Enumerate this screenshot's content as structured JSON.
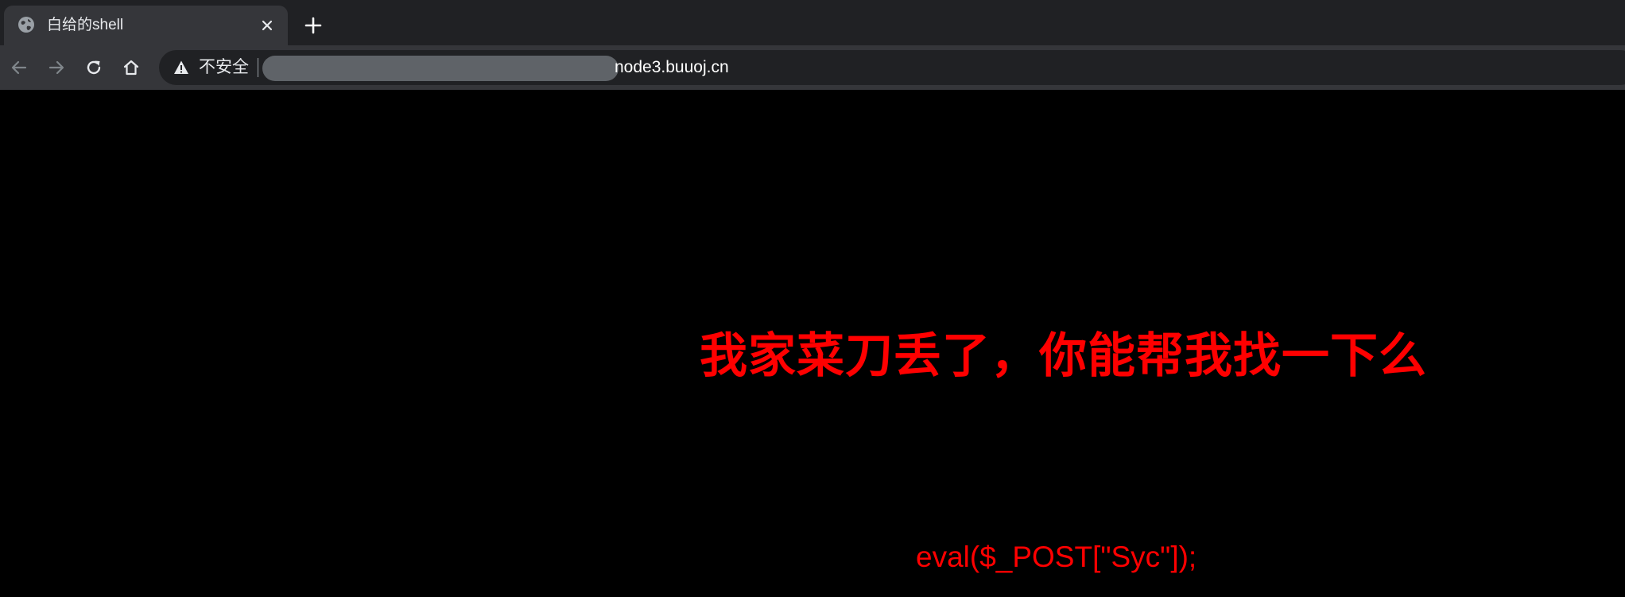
{
  "tab": {
    "title": "白给的shell",
    "favicon": "globe-icon",
    "close_icon": "close-icon"
  },
  "new_tab_icon": "plus-icon",
  "toolbar": {
    "back_icon": "back-arrow-icon",
    "forward_icon": "forward-arrow-icon",
    "reload_icon": "reload-icon",
    "home_icon": "home-icon"
  },
  "omnibox": {
    "security_icon": "warning-icon",
    "security_label": "不安全",
    "url_visible": "node3.buuoj.cn"
  },
  "page": {
    "headline": "我家菜刀丢了，你能帮我找一下么",
    "code": "eval($_POST[\"Syc\"]);"
  },
  "colors": {
    "page_background": "#000000",
    "text_accent": "#ff0000",
    "tab_strip": "#202124",
    "toolbar": "#35363a"
  }
}
